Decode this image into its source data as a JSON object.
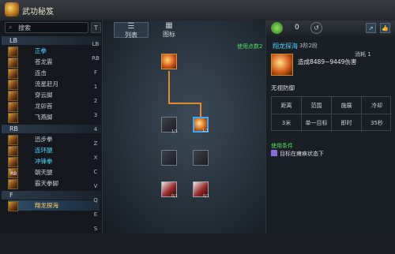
{
  "window": {
    "title": "武功秘笈"
  },
  "left": {
    "search_icon": "search-icon",
    "search_label": "搜索",
    "filter_btn": "T",
    "groups": [
      {
        "label": "LB",
        "items": [
          {
            "key": "",
            "name": "正拳",
            "selected": true
          },
          {
            "key": "",
            "name": "苍龙震"
          },
          {
            "key": "",
            "name": "连击"
          },
          {
            "key": "",
            "name": "流星赶月"
          },
          {
            "key": "",
            "name": "穿云脚"
          },
          {
            "key": "",
            "name": "龙卯首"
          },
          {
            "key": "",
            "name": "飞燕脚"
          }
        ]
      },
      {
        "label": "RB",
        "items": [
          {
            "key": "",
            "name": "迅步拳"
          },
          {
            "key": "",
            "name": "连环腿",
            "selected": true
          },
          {
            "key": "",
            "name": "冲锋拳",
            "selected": true
          },
          {
            "key": "RB",
            "name": "朝天腿"
          },
          {
            "key": "",
            "name": "霸天拳脚"
          }
        ]
      },
      {
        "label": "F",
        "items": [
          {
            "key": "",
            "name": "翔龙探海",
            "highlight": true
          }
        ]
      }
    ],
    "hotkeys": [
      "LB",
      "RB",
      "F",
      "1",
      "2",
      "3",
      "4",
      "Z",
      "X",
      "C",
      "V",
      "Q",
      "E",
      "S"
    ]
  },
  "middle": {
    "tabs": [
      {
        "label": "列表",
        "active": true
      },
      {
        "label": "图标",
        "active": false
      }
    ],
    "used_points_label": "使用点数2",
    "node_subs": [
      "1/1",
      "0/1",
      "1/1"
    ]
  },
  "right": {
    "header": {
      "points": "0"
    },
    "skill": {
      "name": "翔龙探海",
      "stage": "3阶2段",
      "consume": "消耗 1",
      "damage": "造成8489~9449伤害",
      "no_defense": "无视防御",
      "stats_headers": [
        "距离",
        "范围",
        "施展",
        "冷却"
      ],
      "stats_values": [
        "3米",
        "单一目标",
        "即时",
        "35秒"
      ],
      "condition_title": "使用条件",
      "condition_text": "目标在瘫痪状态下"
    }
  }
}
